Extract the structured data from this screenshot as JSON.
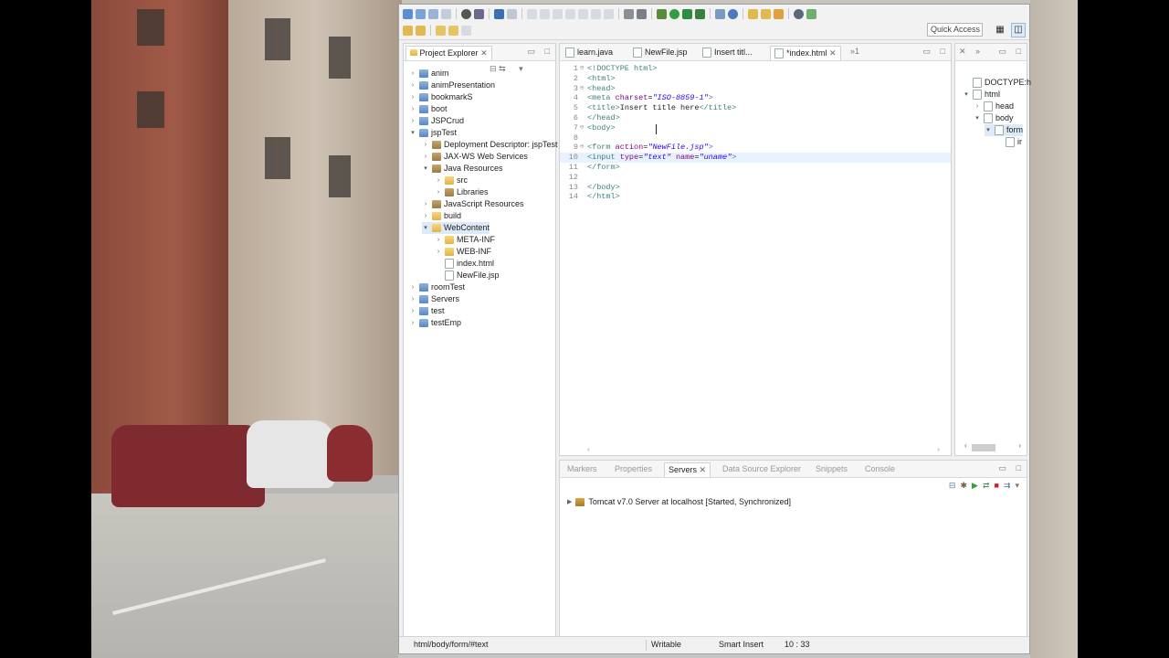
{
  "toolbar": {
    "quick_access_placeholder": "Quick Access"
  },
  "project_explorer": {
    "title": "Project Explorer",
    "items": [
      {
        "label": "anim",
        "depth": 0,
        "arrow": "right",
        "icon": "proj"
      },
      {
        "label": "animPresentation",
        "depth": 0,
        "arrow": "right",
        "icon": "proj"
      },
      {
        "label": "bookmarkS",
        "depth": 0,
        "arrow": "right",
        "icon": "proj"
      },
      {
        "label": "boot",
        "depth": 0,
        "arrow": "right",
        "icon": "proj"
      },
      {
        "label": "JSPCrud",
        "depth": 0,
        "arrow": "right",
        "icon": "proj"
      },
      {
        "label": "jspTest",
        "depth": 0,
        "arrow": "down",
        "icon": "proj"
      },
      {
        "label": "Deployment Descriptor: jspTest",
        "depth": 1,
        "arrow": "right",
        "icon": "lib"
      },
      {
        "label": "JAX-WS Web Services",
        "depth": 1,
        "arrow": "right",
        "icon": "lib"
      },
      {
        "label": "Java Resources",
        "depth": 1,
        "arrow": "down",
        "icon": "lib"
      },
      {
        "label": "src",
        "depth": 2,
        "arrow": "right",
        "icon": "folder"
      },
      {
        "label": "Libraries",
        "depth": 2,
        "arrow": "right",
        "icon": "lib"
      },
      {
        "label": "JavaScript Resources",
        "depth": 1,
        "arrow": "right",
        "icon": "lib"
      },
      {
        "label": "build",
        "depth": 1,
        "arrow": "right",
        "icon": "folder"
      },
      {
        "label": "WebContent",
        "depth": 1,
        "arrow": "down",
        "icon": "folder",
        "selected": true
      },
      {
        "label": "META-INF",
        "depth": 2,
        "arrow": "right",
        "icon": "folder"
      },
      {
        "label": "WEB-INF",
        "depth": 2,
        "arrow": "right",
        "icon": "folder"
      },
      {
        "label": "index.html",
        "depth": 2,
        "arrow": "",
        "icon": "file"
      },
      {
        "label": "NewFile.jsp",
        "depth": 2,
        "arrow": "",
        "icon": "file"
      },
      {
        "label": "roomTest",
        "depth": 0,
        "arrow": "right",
        "icon": "proj"
      },
      {
        "label": "Servers",
        "depth": 0,
        "arrow": "right",
        "icon": "proj"
      },
      {
        "label": "test",
        "depth": 0,
        "arrow": "right",
        "icon": "proj"
      },
      {
        "label": "testEmp",
        "depth": 0,
        "arrow": "right",
        "icon": "proj"
      }
    ]
  },
  "editor": {
    "tabs": [
      {
        "label": "learn.java"
      },
      {
        "label": "NewFile.jsp"
      },
      {
        "label": "Insert titl..."
      },
      {
        "label": "*index.html",
        "active": true
      }
    ],
    "overflow_label": "»1",
    "lines": [
      {
        "n": "1",
        "fold": "⊖",
        "html": "<span class='kw'>&lt;!DOCTYPE html&gt;</span>"
      },
      {
        "n": "2",
        "fold": "",
        "html": "<span class='kw'>&lt;html&gt;</span>"
      },
      {
        "n": "3",
        "fold": "⊖",
        "html": "<span class='kw'>&lt;head&gt;</span>"
      },
      {
        "n": "4",
        "fold": "",
        "html": "<span class='kw'>&lt;meta</span> <span class='at'>charset</span>=<span class='st'>\"ISO-8859-1\"</span><span class='kw'>&gt;</span>"
      },
      {
        "n": "5",
        "fold": "",
        "html": "<span class='kw'>&lt;title&gt;</span>Insert title here<span class='kw'>&lt;/title&gt;</span>"
      },
      {
        "n": "6",
        "fold": "",
        "html": "<span class='kw'>&lt;/head&gt;</span>"
      },
      {
        "n": "7",
        "fold": "⊖",
        "html": "<span class='kw'>&lt;body&gt;</span>"
      },
      {
        "n": "8",
        "fold": "",
        "html": ""
      },
      {
        "n": "9",
        "fold": "⊖",
        "html": "<span class='kw'>&lt;form</span> <span class='at'>action</span>=<span class='st'>\"NewFile.jsp\"</span><span class='kw'>&gt;</span>"
      },
      {
        "n": "10",
        "fold": "",
        "html": "<span class='kw'>&lt;input</span> <span class='at'>type</span>=<span class='st'>\"text\"</span> <span class='at'>name</span>=<span class='st'>\"uname\"</span><span class='kw'>&gt;</span>"
      },
      {
        "n": "11",
        "fold": "",
        "html": "<span class='kw'>&lt;/form&gt;</span>"
      },
      {
        "n": "12",
        "fold": "",
        "html": ""
      },
      {
        "n": "13",
        "fold": "",
        "html": "<span class='kw'>&lt;/body&gt;</span>"
      },
      {
        "n": "14",
        "fold": "",
        "html": "<span class='kw'>&lt;/html&gt;</span>"
      }
    ]
  },
  "outline": {
    "items": [
      {
        "label": "DOCTYPE:h",
        "depth": 0,
        "arrow": ""
      },
      {
        "label": "html",
        "depth": 0,
        "arrow": "down"
      },
      {
        "label": "head",
        "depth": 1,
        "arrow": "right"
      },
      {
        "label": "body",
        "depth": 1,
        "arrow": "down"
      },
      {
        "label": "form",
        "depth": 2,
        "arrow": "down",
        "selected": true
      },
      {
        "label": "ir",
        "depth": 3,
        "arrow": ""
      }
    ]
  },
  "bottom_panel": {
    "tabs": [
      {
        "label": "Markers"
      },
      {
        "label": "Properties"
      },
      {
        "label": "Servers",
        "active": true
      },
      {
        "label": "Data Source Explorer"
      },
      {
        "label": "Snippets"
      },
      {
        "label": "Console"
      }
    ],
    "server_entry": "Tomcat v7.0 Server at localhost  [Started, Synchronized]"
  },
  "status_bar": {
    "path": "html/body/form/#text",
    "writable": "Writable",
    "insert_mode": "Smart Insert",
    "position": "10 : 33"
  }
}
